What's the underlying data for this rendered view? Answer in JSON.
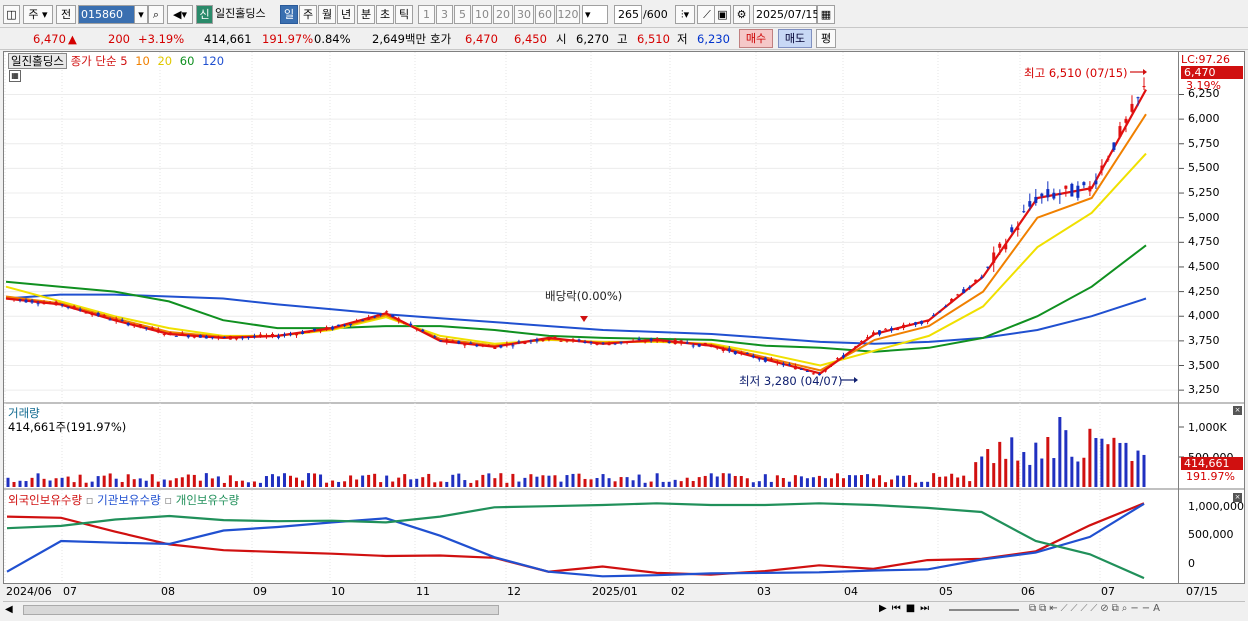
{
  "toolbar": {
    "market_type": "주",
    "prev_label": "전",
    "stock_code": "015860",
    "new_badge": "신",
    "stock_name": "일진홀딩스",
    "periods": [
      "일",
      "주",
      "월",
      "년",
      "분",
      "초",
      "틱"
    ],
    "active_period": "일",
    "intervals": [
      "1",
      "3",
      "5",
      "10",
      "20",
      "30",
      "60",
      "120"
    ],
    "count": "265",
    "count_max": "/600",
    "date": "2025/07/15"
  },
  "quote": {
    "price": "6,470",
    "change": "200",
    "change_pct": "+3.19%",
    "volume": "414,661",
    "volume_ratio": "191.97%",
    "turnover": "0.84%",
    "amount": "2,649백만",
    "ask_label": "호가",
    "ask": "6,470",
    "bid": "6,450",
    "open_label": "시",
    "open": "6,270",
    "high_label": "고",
    "high": "6,510",
    "low_label": "저",
    "low": "6,230",
    "buy_label": "매수",
    "sell_label": "매도",
    "flat_label": "평"
  },
  "price_pane": {
    "legend_name": "일진홀딩스",
    "legend_ma": "종가 단순",
    "ma_periods": [
      "5",
      "10",
      "20",
      "60",
      "120"
    ],
    "ma_colors": [
      "#e01010",
      "#f08000",
      "#f0e000",
      "#109020",
      "#2050d0"
    ],
    "high_annotation": "최고 6,510 (07/15)",
    "low_annotation": "최저 3,280 (04/07)",
    "dividend_annotation": "배당락(0.00%)",
    "lc_label": "LC:97.26",
    "last_price_tag": "6,470",
    "last_pct_tag": "3.19%",
    "y_ticks": [
      "6,250",
      "6,000",
      "5,750",
      "5,500",
      "5,250",
      "5,000",
      "4,750",
      "4,500",
      "4,250",
      "4,000",
      "3,750",
      "3,500",
      "3,250"
    ]
  },
  "volume_pane": {
    "title": "거래량",
    "value_label": "414,661주(191.97%)",
    "y_ticks": [
      "1,000K",
      "500,000"
    ],
    "last_tag": "414,661",
    "last_pct": "191.97%"
  },
  "holding_pane": {
    "series": [
      "외국인보유수량",
      "기관보유수량",
      "개인보유수량"
    ],
    "colors": [
      "#d01010",
      "#2050d0",
      "#20905a"
    ],
    "y_ticks": [
      "1,000,000",
      "500,000",
      "0"
    ]
  },
  "x_axis": {
    "labels": [
      "2024/06",
      "07",
      "08",
      "09",
      "10",
      "11",
      "12",
      "2025/01",
      "02",
      "03",
      "04",
      "05",
      "06",
      "07"
    ],
    "right_label": "07/15"
  },
  "chart_data": {
    "type": "line",
    "price_ma": [
      {
        "name": "5",
        "values": [
          4180,
          4120,
          3960,
          3820,
          3780,
          3800,
          3880,
          4030,
          3750,
          3690,
          3780,
          3720,
          3760,
          3700,
          3560,
          3420,
          3820,
          3960,
          4400,
          5200,
          5300,
          6300
        ]
      },
      {
        "name": "10",
        "values": [
          4200,
          4130,
          3980,
          3840,
          3790,
          3800,
          3870,
          4010,
          3770,
          3700,
          3770,
          3730,
          3750,
          3710,
          3580,
          3450,
          3760,
          3900,
          4250,
          5000,
          5200,
          6050
        ]
      },
      {
        "name": "20",
        "values": [
          4300,
          4150,
          4000,
          3880,
          3800,
          3800,
          3860,
          3990,
          3800,
          3720,
          3760,
          3740,
          3740,
          3720,
          3620,
          3500,
          3650,
          3800,
          4100,
          4700,
          5050,
          5650
        ]
      },
      {
        "name": "60",
        "values": [
          4350,
          4300,
          4250,
          4150,
          3960,
          3880,
          3880,
          3900,
          3900,
          3860,
          3800,
          3780,
          3770,
          3760,
          3700,
          3680,
          3640,
          3680,
          3780,
          4000,
          4300,
          4720
        ]
      },
      {
        "name": "120",
        "values": [
          4180,
          4220,
          4220,
          4200,
          4180,
          4120,
          4070,
          4020,
          3980,
          3940,
          3900,
          3860,
          3840,
          3820,
          3780,
          3740,
          3720,
          3740,
          3780,
          3860,
          4000,
          4180
        ]
      }
    ],
    "x_months": [
      "2024/06",
      "07",
      "08",
      "09",
      "10",
      "11",
      "12",
      "2025/01",
      "02",
      "03",
      "04",
      "05",
      "06",
      "07"
    ],
    "y_range": [
      3150,
      6600
    ]
  }
}
